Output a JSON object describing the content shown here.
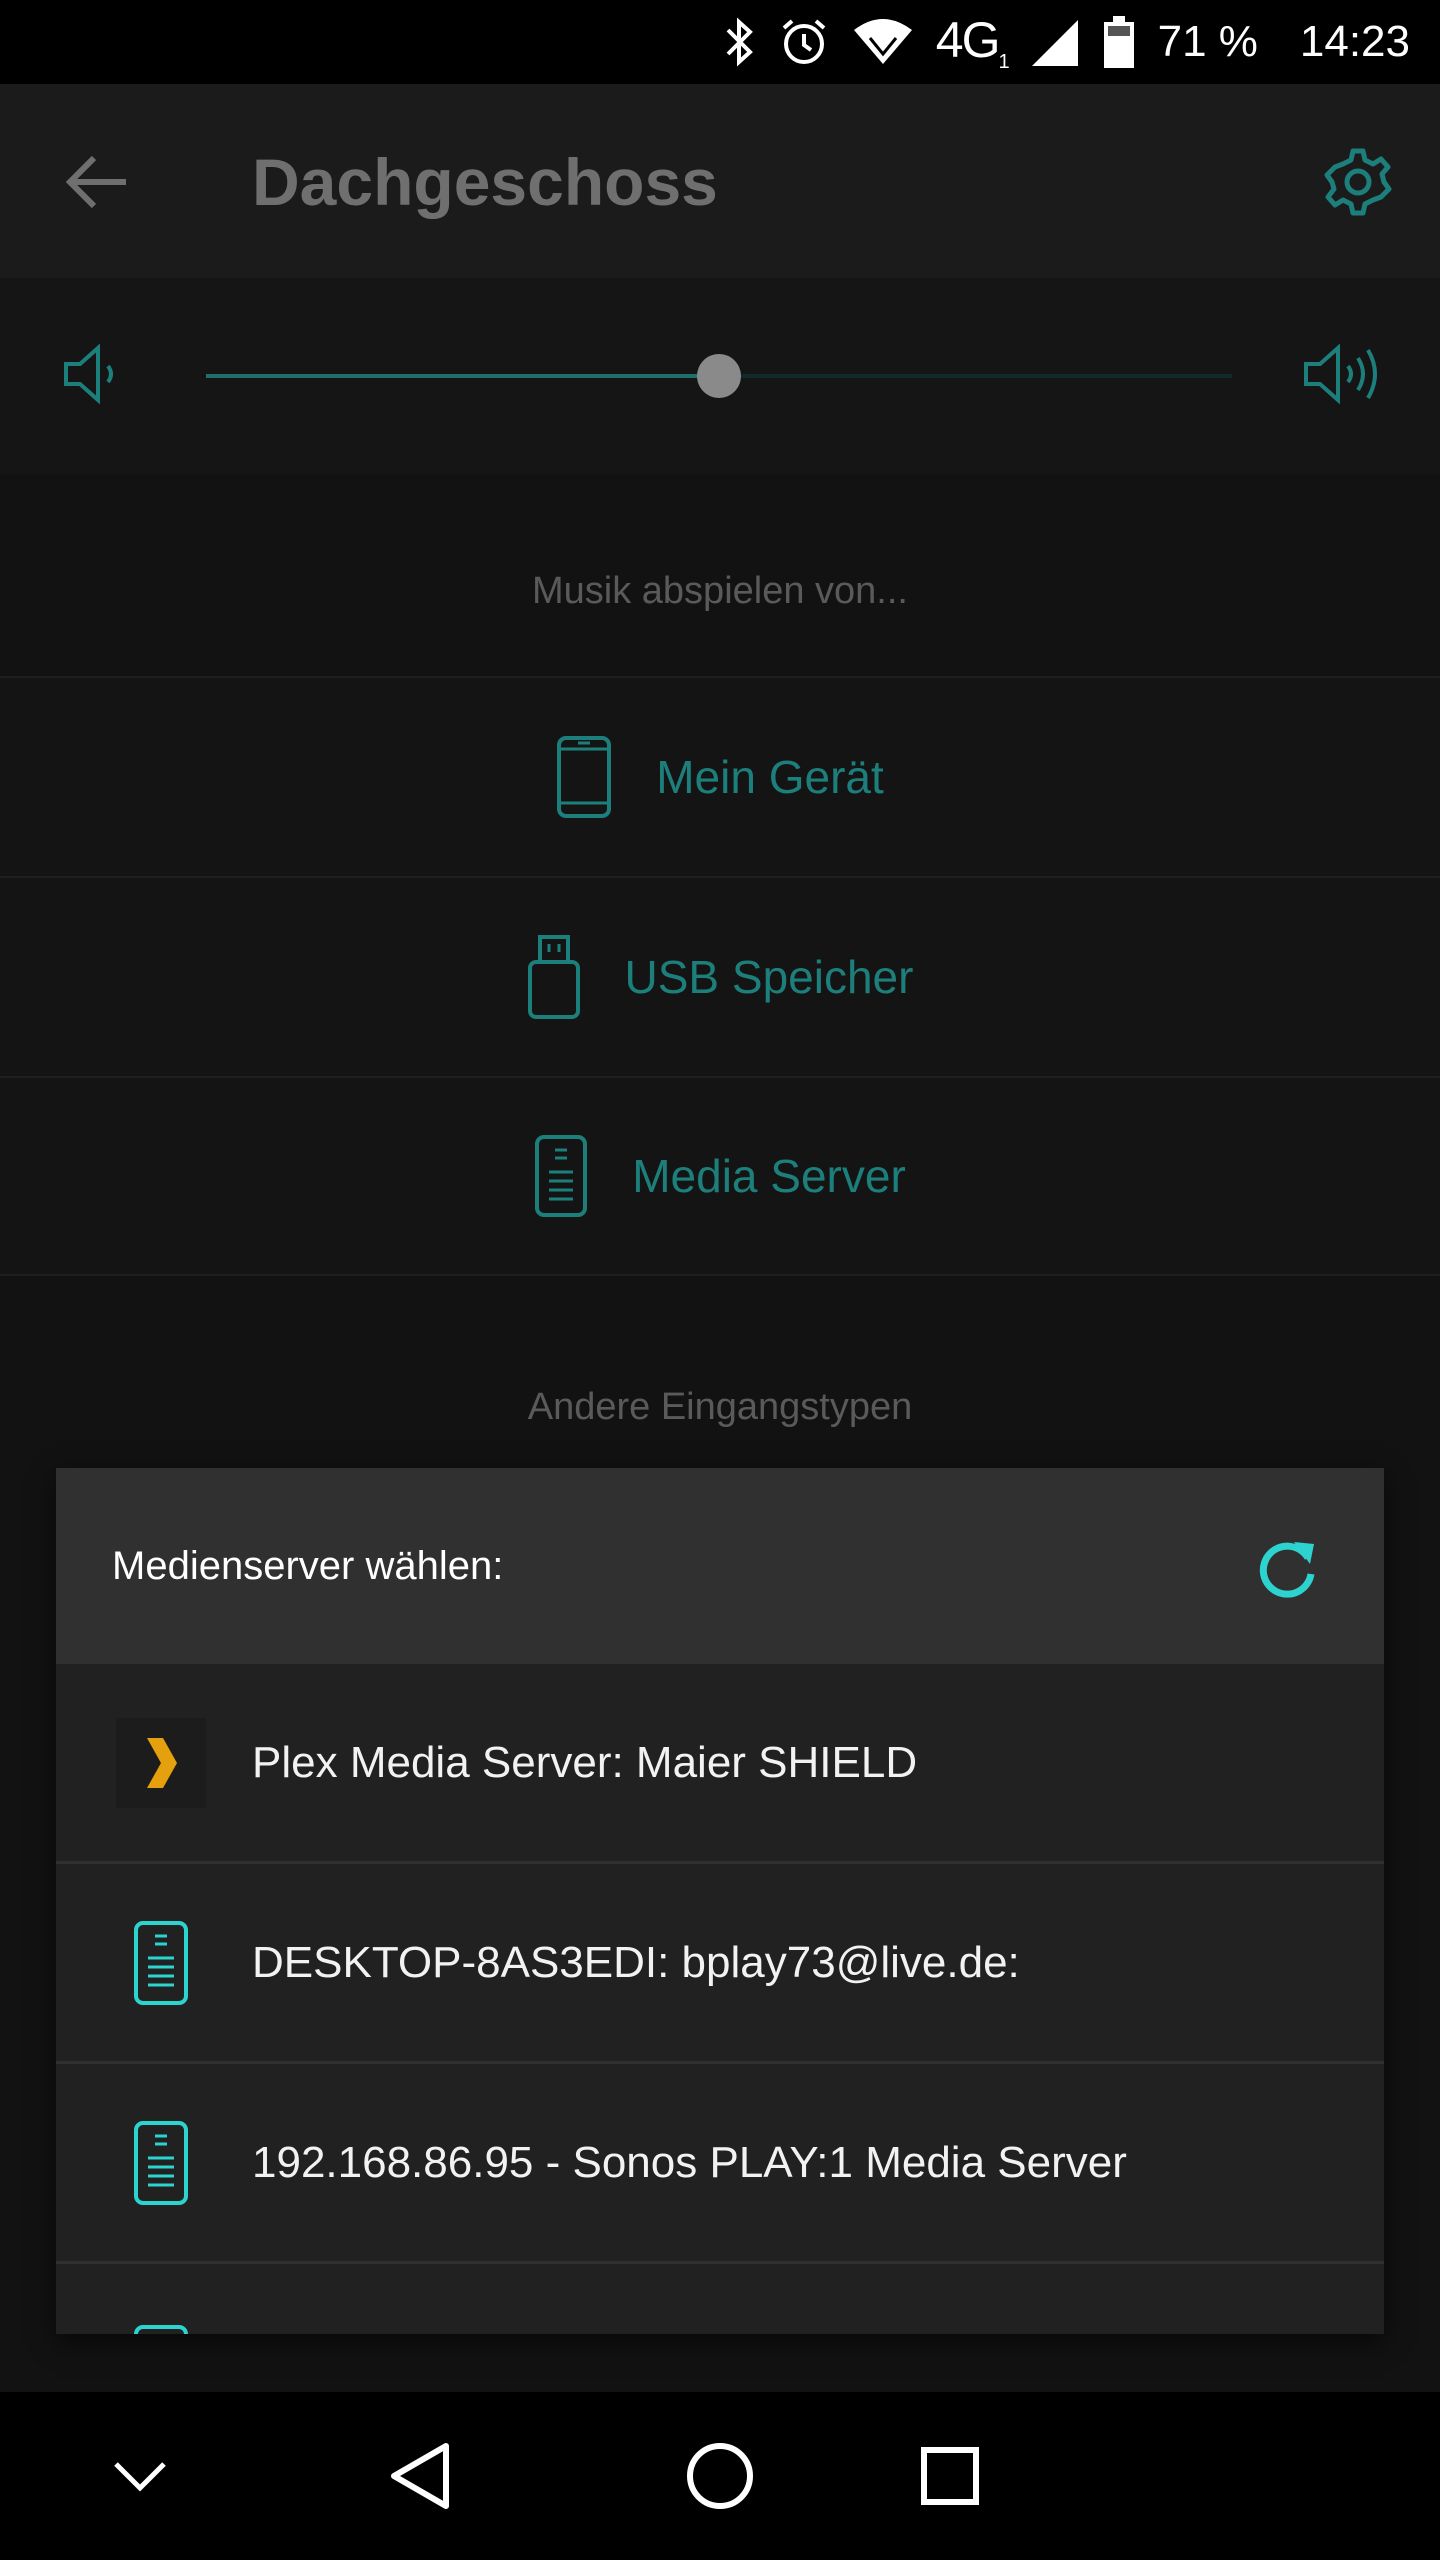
{
  "status_bar": {
    "network": "4G",
    "network_sub": "1",
    "battery": "71 %",
    "time": "14:23"
  },
  "toolbar": {
    "title": "Dachgeschoss"
  },
  "volume": {
    "level": 0.5
  },
  "sources": {
    "header": "Musik abspielen von...",
    "items": [
      {
        "label": "Mein Gerät",
        "icon": "phone-icon"
      },
      {
        "label": "USB Speicher",
        "icon": "usb-icon"
      },
      {
        "label": "Media Server",
        "icon": "server-icon"
      }
    ],
    "other_header": "Andere Eingangstypen"
  },
  "dialog": {
    "title": "Medienserver wählen:",
    "servers": [
      {
        "name": "Plex Media Server: Maier SHIELD",
        "icon": "plex-icon"
      },
      {
        "name": "DESKTOP-8AS3EDI: bplay73@live.de:",
        "icon": "server-icon"
      },
      {
        "name": "192.168.86.95 - Sonos PLAY:1 Media Server",
        "icon": "server-icon"
      }
    ]
  },
  "colors": {
    "accent": "#1d7f7b",
    "accent_bright": "#2cd3cf",
    "plex_orange": "#e5a00d"
  }
}
